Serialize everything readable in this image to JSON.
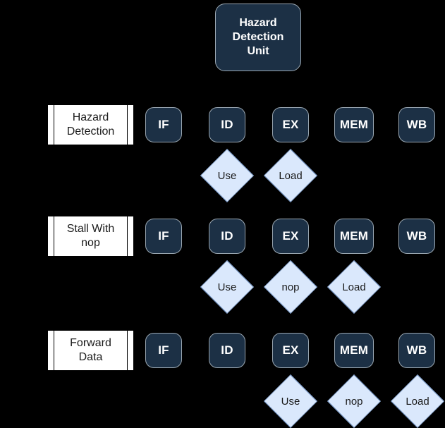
{
  "diagram": {
    "title_unit": {
      "lines": [
        "Hazard",
        "Detection",
        "Unit"
      ]
    },
    "colors": {
      "background": "#000000",
      "unit_fill": "#1c3045",
      "unit_border": "#9aa7b2",
      "unit_text": "#ffffff",
      "label_fill": "#ffffff",
      "label_border": "#000000",
      "diamond_fill": "#dae8fc",
      "diamond_border": "#6c8ebf",
      "diamond_text": "#1a1a1a"
    },
    "rows": [
      {
        "label": "Hazard Detection",
        "label_lines": [
          "Hazard",
          "Detection"
        ],
        "stages": [
          "IF",
          "ID",
          "EX",
          "MEM",
          "WB"
        ],
        "diamonds": [
          "Use",
          "Load"
        ]
      },
      {
        "label": "Stall With nop",
        "label_lines": [
          "Stall With",
          "nop"
        ],
        "stages": [
          "IF",
          "ID",
          "EX",
          "MEM",
          "WB"
        ],
        "diamonds": [
          "Use",
          "nop",
          "Load"
        ]
      },
      {
        "label": "Forward Data",
        "label_lines": [
          "Forward",
          "Data"
        ],
        "stages": [
          "IF",
          "ID",
          "EX",
          "MEM",
          "WB"
        ],
        "diamonds": [
          "Use",
          "nop",
          "Load"
        ]
      }
    ]
  }
}
